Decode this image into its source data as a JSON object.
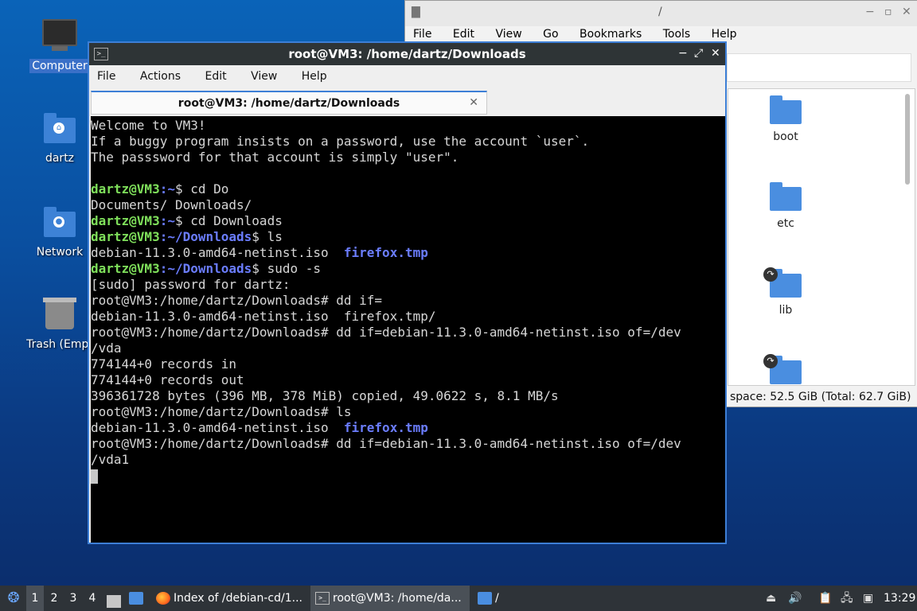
{
  "desktop": {
    "icons": [
      {
        "label": "Computer"
      },
      {
        "label": "dartz"
      },
      {
        "label": "Network"
      },
      {
        "label": "Trash (Empt"
      }
    ]
  },
  "file_manager": {
    "title": "/",
    "menu": [
      "File",
      "Edit",
      "View",
      "Go",
      "Bookmarks",
      "Tools",
      "Help"
    ],
    "items": [
      {
        "label": "boot"
      },
      {
        "label": "etc"
      },
      {
        "label": "lib"
      }
    ],
    "status": "space: 52.5 GiB (Total: 62.7 GiB)"
  },
  "terminal": {
    "title": "root@VM3: /home/dartz/Downloads",
    "menu": [
      "File",
      "Actions",
      "Edit",
      "View",
      "Help"
    ],
    "tab_label": "root@VM3: /home/dartz/Downloads",
    "lines": [
      "Welcome to VM3!",
      "If a buggy program insists on a password, use the account `user`.",
      "The passsword for that account is simply \"user\".",
      "",
      "cd Do",
      "Documents/ Downloads/",
      "cd Downloads",
      "ls",
      "debian-11.3.0-amd64-netinst.iso  ",
      "firefox.tmp",
      "sudo -s",
      "[sudo] password for dartz:",
      "root@VM3:/home/dartz/Downloads# dd if=",
      "debian-11.3.0-amd64-netinst.iso  firefox.tmp/",
      "root@VM3:/home/dartz/Downloads# dd if=debian-11.3.0-amd64-netinst.iso of=/dev",
      "/vda",
      "774144+0 records in",
      "774144+0 records out",
      "396361728 bytes (396 MB, 378 MiB) copied, 49.0622 s, 8.1 MB/s",
      "root@VM3:/home/dartz/Downloads# ls",
      "debian-11.3.0-amd64-netinst.iso  ",
      "firefox.tmp",
      "root@VM3:/home/dartz/Downloads# dd if=debian-11.3.0-amd64-netinst.iso of=/dev",
      "/vda1"
    ],
    "prompt_user": "dartz@VM3",
    "prompt_home": ":~",
    "prompt_dl": ":~/Downloads",
    "prompt_sign": "$ "
  },
  "taskbar": {
    "workspaces": [
      "1",
      "2",
      "3",
      "4"
    ],
    "tasks": [
      {
        "label": "Index of /debian-cd/1..."
      },
      {
        "label": "root@VM3: /home/da..."
      },
      {
        "label": "/"
      }
    ],
    "clock": "13:29"
  }
}
